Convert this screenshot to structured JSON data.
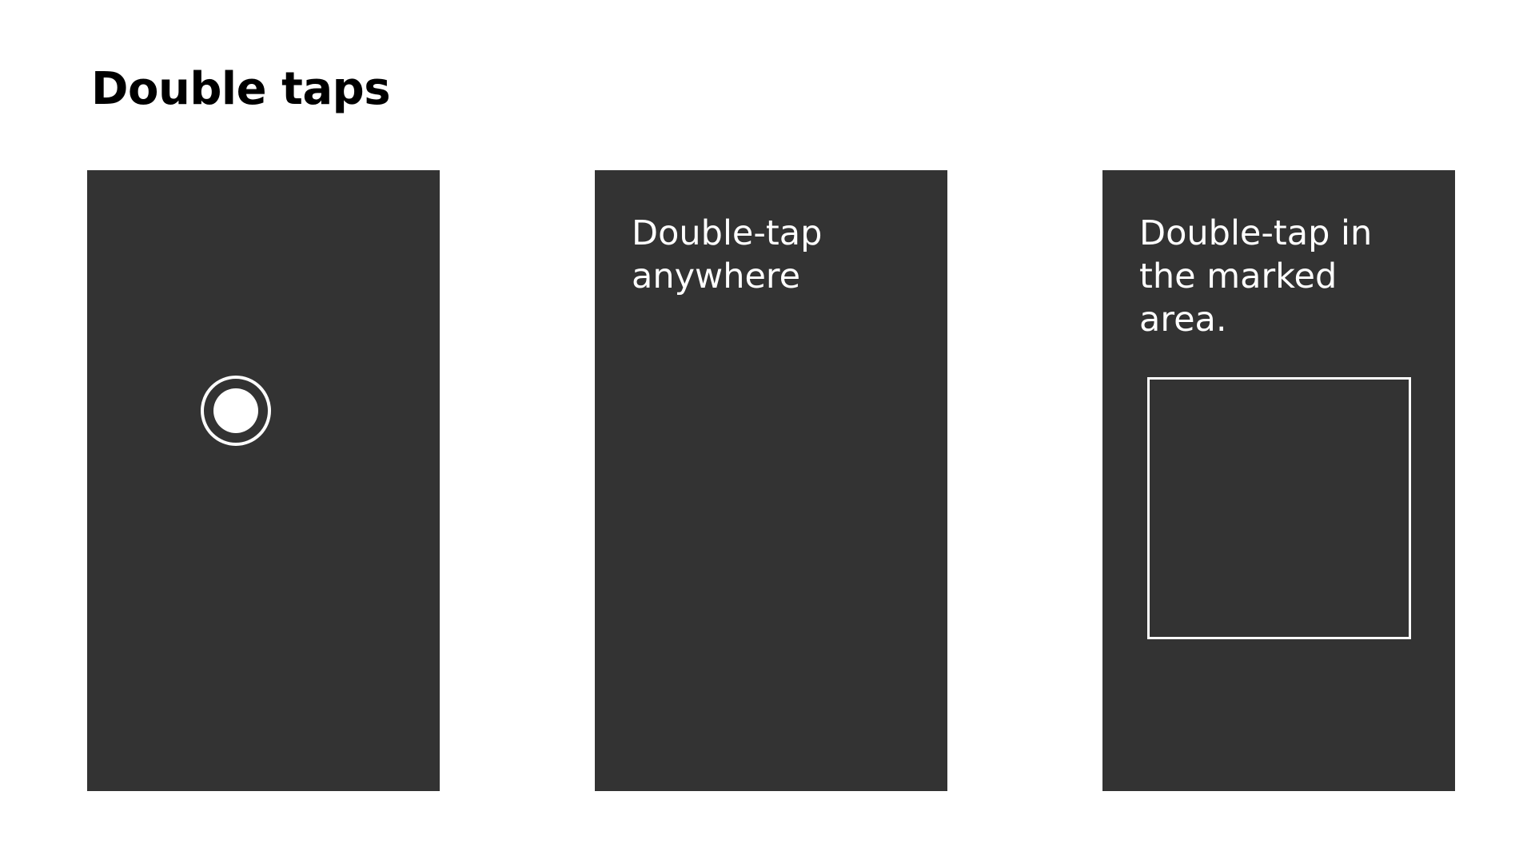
{
  "title": "Double taps",
  "colors": {
    "background": "#ffffff",
    "panel": "#333333",
    "foreground": "#ffffff",
    "title": "#000000"
  },
  "panels": [
    {
      "text": "",
      "indicator_icon": "tap-indicator-icon"
    },
    {
      "text": "Double-tap anywhere"
    },
    {
      "text": "Double-tap in the marked area.",
      "marked_area": true
    }
  ]
}
